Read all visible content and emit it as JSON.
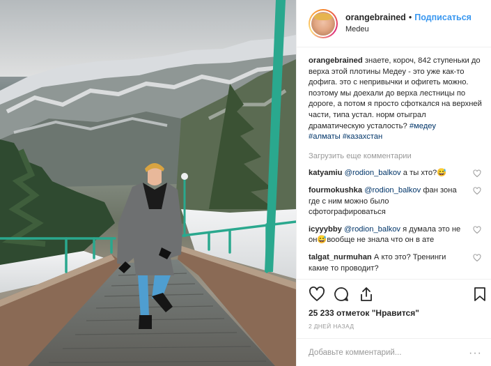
{
  "post": {
    "photo_alt": "",
    "header": {
      "username": "orangebrained",
      "separator": "•",
      "follow_label": "Подписаться",
      "location": "Medeu"
    },
    "caption": {
      "username": "orangebrained",
      "text": " знаете, короч, 842 ступеньки до верха этой плотины Медеу - это уже как-то дофига. это с непривычки и офигеть можно. поэтому мы доехали до верха лестницы по дороге, а потом я просто сфоткался на верхней части, типа устал. норм отыграл драматическую усталость? ",
      "tags": [
        "#медеу",
        "#алматы",
        "#казахстан"
      ]
    },
    "load_more_label": "Загрузить еще комментарии",
    "comments": [
      {
        "username": "katyamiu",
        "mention": "@rodion_balkov",
        "text": " а ты хто?😅"
      },
      {
        "username": "fourmokushka",
        "mention": "@rodion_balkov",
        "text": " фан зона где с ним можно было сфотографироваться"
      },
      {
        "username": "icyyybby",
        "mention": "@rodion_balkov",
        "text": " я думала это не он😅вообще не знала что он в ате"
      },
      {
        "username": "talgat_nurmuhan",
        "mention": "",
        "text": " А кто это? Тренинги какие то проводит?"
      }
    ],
    "actions": {
      "like_icon": "heart-icon",
      "comment_icon": "comment-icon",
      "share_icon": "share-icon",
      "save_icon": "bookmark-icon"
    },
    "likes_label": "25 233 отметок \"Нравится\"",
    "timestamp": "2 ДНЕЙ НАЗАД",
    "add_comment_placeholder": "Добавьте комментарий...",
    "more_options": "···",
    "colors": {
      "link": "#3897f0",
      "hashtag": "#003569",
      "muted": "#999999",
      "railing": "#2aa88e"
    }
  }
}
